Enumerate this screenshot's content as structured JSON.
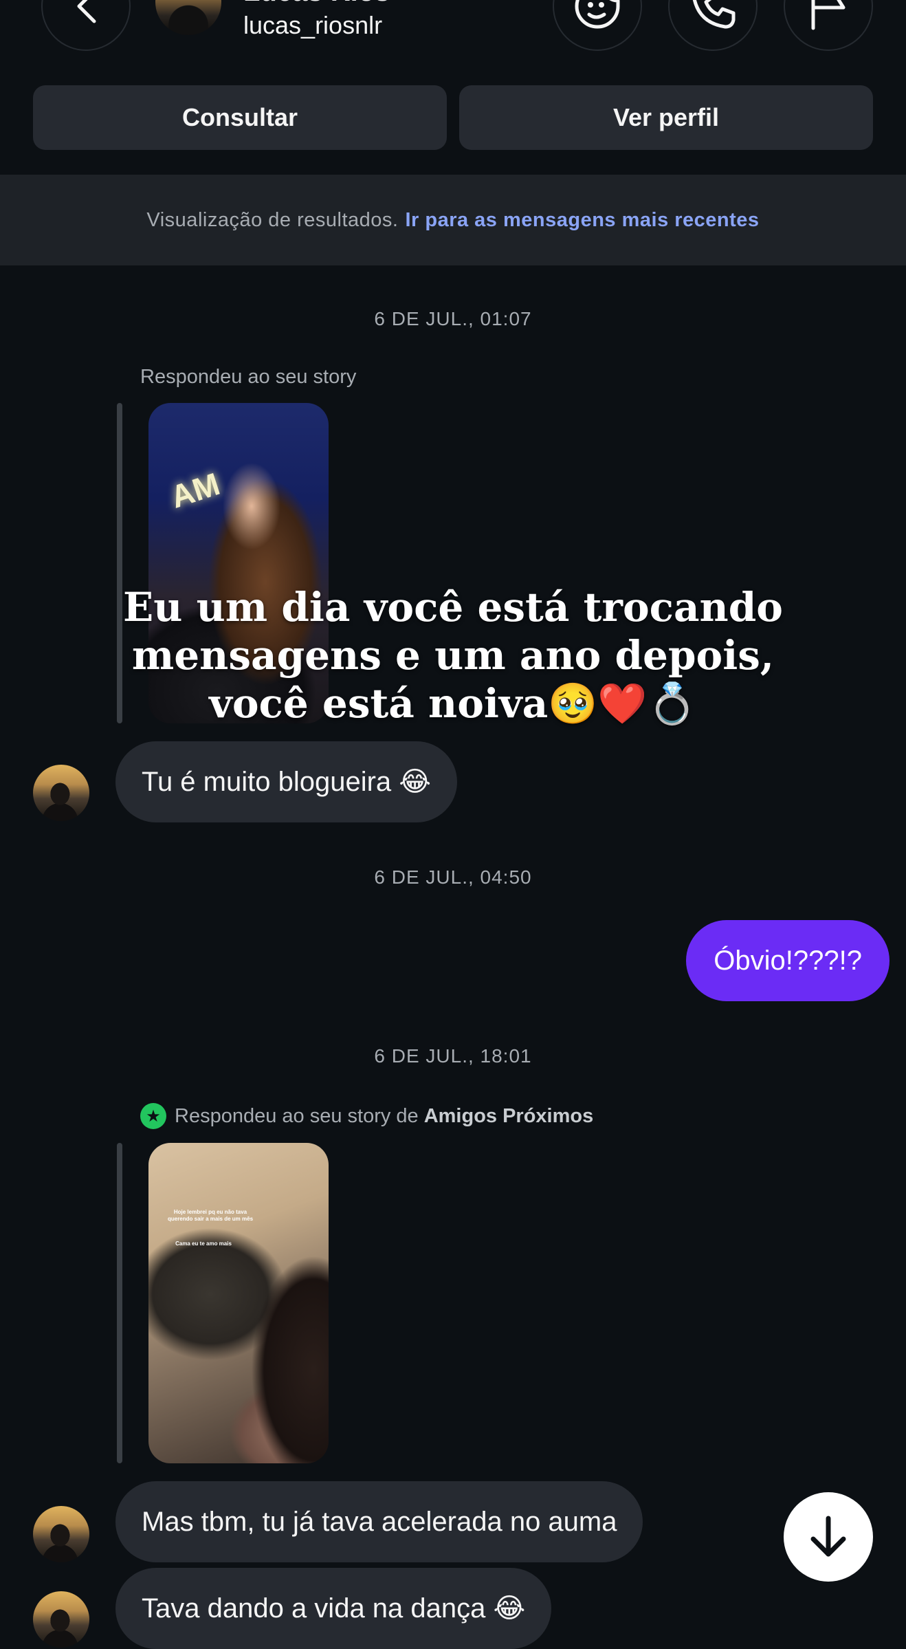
{
  "header": {
    "name": "Lucas Rios",
    "username": "lucas_riosnlr",
    "back_icon": "chevron-left-icon",
    "actions": [
      "sticker-icon",
      "phone-icon",
      "flag-icon"
    ]
  },
  "buttons": {
    "consult_label": "Consultar",
    "profile_label": "Ver perfil"
  },
  "banner": {
    "text": "Visualização de resultados.",
    "link": "Ir para as mensagens mais recentes"
  },
  "messages": {
    "ts1": "6 DE JUL., 01:07",
    "reply1_label": "Respondeu ao seu story",
    "story1_caption": "Eu um dia você está trocando mensagens e um ano depois, você está noiva🥹❤️💍",
    "story1_neon": "AM",
    "msg1": "Tu é muito blogueira 😂",
    "ts2": "6 DE JUL., 04:50",
    "msg2": "Óbvio!???!?",
    "ts3": "6 DE JUL., 18:01",
    "reply2_label": "Respondeu ao seu story de",
    "reply2_audience": "Amigos Próximos",
    "story2_line1": "Hoje lembrei pq eu não tava querendo sair a mais de um mês",
    "story2_line2": "Cama eu te amo mais",
    "msg3": "Mas tbm, tu já tava acelerada no auma",
    "msg4": "Tava dando a vida na dança 😂"
  },
  "colors": {
    "background": "#0c1014",
    "bubble_in": "#262a31",
    "bubble_out": "#6b2cf5",
    "link": "#8aa4f5",
    "close_friends": "#22c55e"
  }
}
